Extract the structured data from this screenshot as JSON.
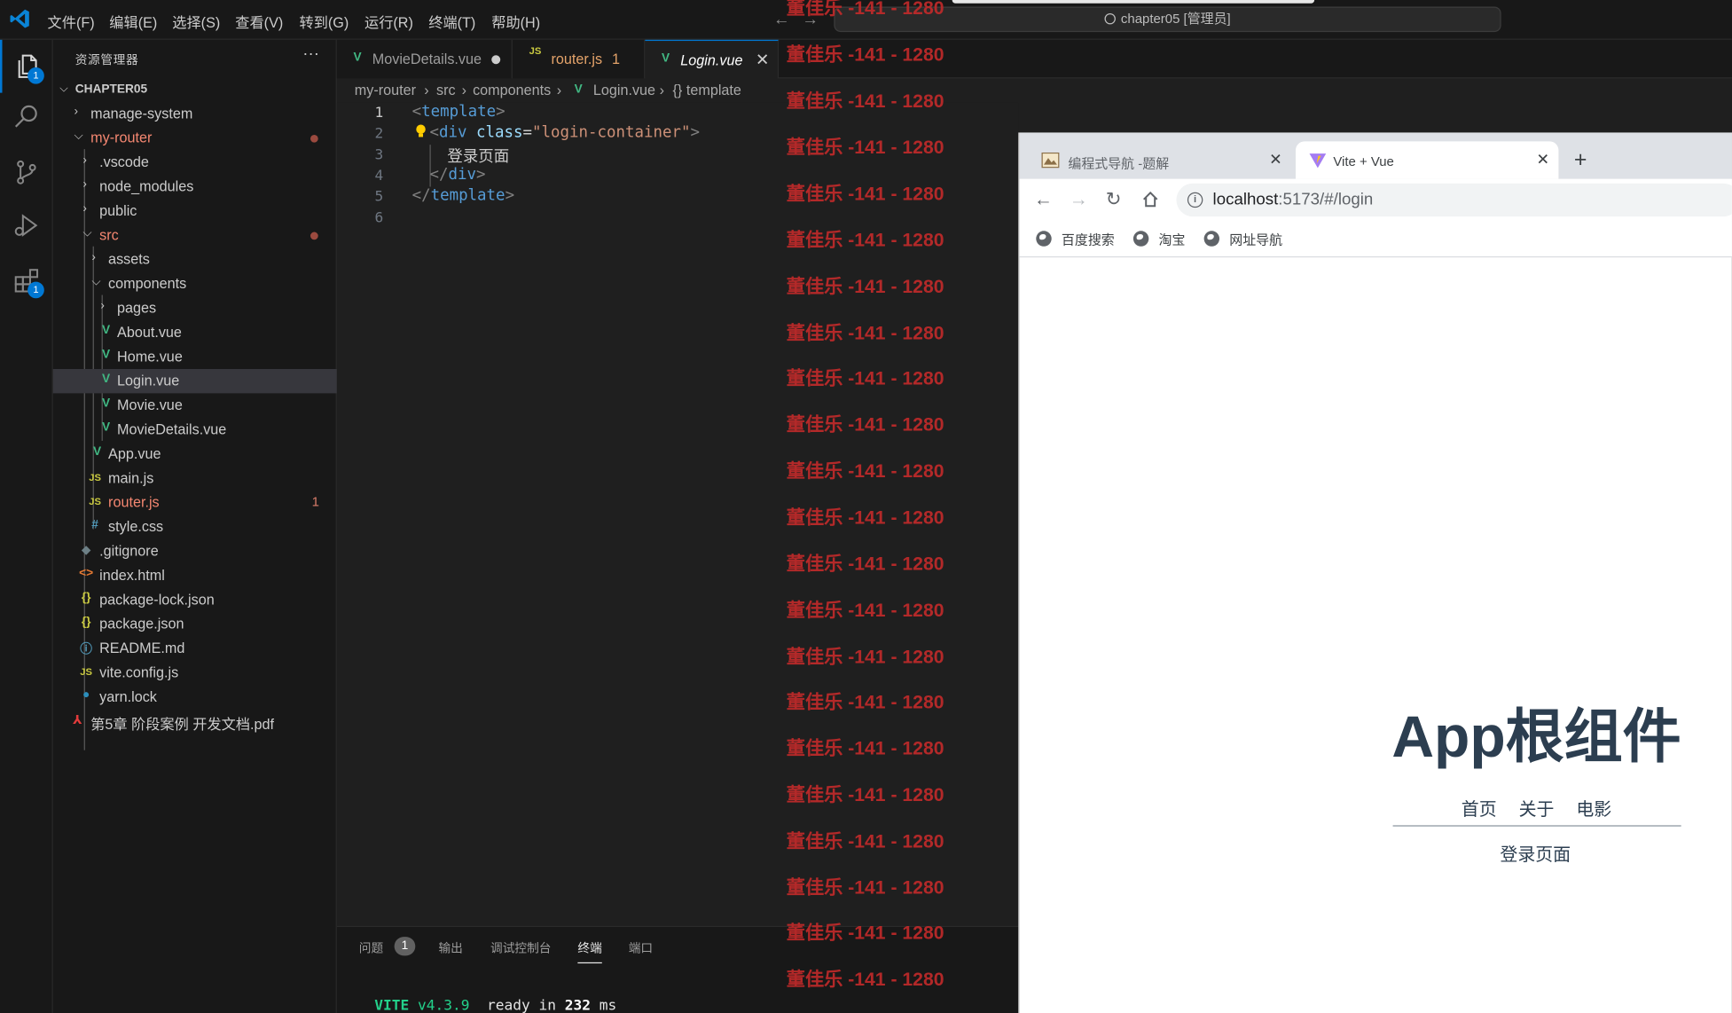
{
  "menu": [
    "文件(F)",
    "编辑(E)",
    "选择(S)",
    "查看(V)",
    "转到(G)",
    "运行(R)",
    "终端(T)",
    "帮助(H)"
  ],
  "command_center": "chapter05 [管理员]",
  "activity_badges": {
    "explorer": "1",
    "extensions": "1"
  },
  "sidebar": {
    "title": "资源管理器",
    "more": "···",
    "section": "CHAPTER05",
    "items": [
      {
        "label": "manage-system"
      },
      {
        "label": "my-router"
      },
      {
        "label": ".vscode"
      },
      {
        "label": "node_modules"
      },
      {
        "label": "public"
      },
      {
        "label": "src"
      },
      {
        "label": "assets"
      },
      {
        "label": "components"
      },
      {
        "label": "pages"
      },
      {
        "label": "About.vue"
      },
      {
        "label": "Home.vue"
      },
      {
        "label": "Login.vue"
      },
      {
        "label": "Movie.vue"
      },
      {
        "label": "MovieDetails.vue"
      },
      {
        "label": "App.vue"
      },
      {
        "label": "main.js"
      },
      {
        "label": "router.js",
        "badge": "1"
      },
      {
        "label": "style.css"
      },
      {
        "label": ".gitignore"
      },
      {
        "label": "index.html"
      },
      {
        "label": "package-lock.json"
      },
      {
        "label": "package.json"
      },
      {
        "label": "README.md"
      },
      {
        "label": "vite.config.js"
      },
      {
        "label": "yarn.lock"
      },
      {
        "label": "第5章 阶段案例 开发文档.pdf"
      }
    ]
  },
  "tabs": [
    {
      "label": "MovieDetails.vue"
    },
    {
      "label": "router.js",
      "badge": "1"
    },
    {
      "label": "Login.vue"
    }
  ],
  "breadcrumb": [
    "my-router",
    "src",
    "components",
    "Login.vue",
    "{} template"
  ],
  "editor": {
    "line_numbers": [
      "1",
      "2",
      "3",
      "4",
      "5",
      "6"
    ],
    "lines": {
      "l1": {
        "open": "<",
        "tag": "template",
        "close": ">"
      },
      "l2": {
        "open": "<",
        "tag": "div",
        "attr": " class",
        "eq": "=",
        "str": "\"login-container\"",
        "close": ">"
      },
      "l3": {
        "text": "登录页面"
      },
      "l4": {
        "open": "</",
        "tag": "div",
        "close": ">"
      },
      "l5": {
        "open": "</",
        "tag": "template",
        "close": ">"
      }
    }
  },
  "panel": {
    "tabs": [
      "问题",
      "输出",
      "调试控制台",
      "终端",
      "端口"
    ],
    "problems_count": "1",
    "terminal": {
      "vite": "VITE",
      "version": "v4.3.9",
      "ready": "ready in",
      "ms": "232",
      "unit": "ms"
    }
  },
  "watermark": "董佳乐 -141 - 1280",
  "browser": {
    "tabs": [
      {
        "label": "编程式导航 -题解"
      },
      {
        "label": "Vite + Vue"
      }
    ],
    "new_tab": "+",
    "url_host": "localhost",
    "url_path": ":5173/#/login",
    "bookmarks": [
      "百度搜索",
      "淘宝",
      "网址导航"
    ],
    "app": {
      "title": "App根组件",
      "nav": [
        "首页",
        "关于",
        "电影"
      ],
      "content": "登录页面"
    }
  }
}
